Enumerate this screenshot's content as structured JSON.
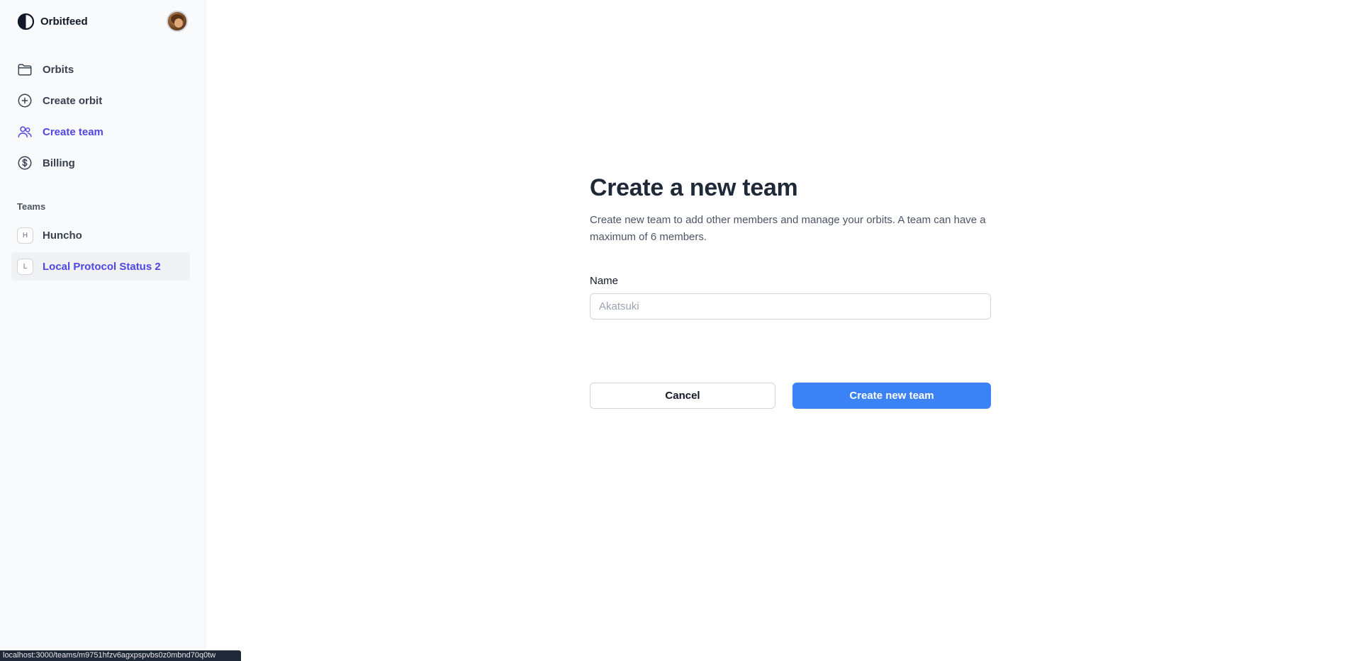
{
  "brand": {
    "name": "Orbitfeed",
    "logo_icon": "half-circle-logo-icon"
  },
  "nav": {
    "items": [
      {
        "label": "Orbits",
        "icon": "folder-icon",
        "active": false
      },
      {
        "label": "Create orbit",
        "icon": "plus-circle-icon",
        "active": false
      },
      {
        "label": "Create team",
        "icon": "users-icon",
        "active": true
      },
      {
        "label": "Billing",
        "icon": "dollar-circle-icon",
        "active": false
      }
    ]
  },
  "teams": {
    "heading": "Teams",
    "items": [
      {
        "initial": "H",
        "name": "Huncho",
        "active": false
      },
      {
        "initial": "L",
        "name": "Local Protocol Status 2",
        "active": true
      }
    ]
  },
  "form": {
    "title": "Create a new team",
    "description": "Create new team to add other members and manage your orbits. A team can have a maximum of 6 members.",
    "name_label": "Name",
    "name_placeholder": "Akatsuki",
    "name_value": "",
    "cancel_label": "Cancel",
    "submit_label": "Create new team"
  },
  "status_bar": {
    "url": "localhost:3000/teams/m9751hfzv6agxpspvbs0z0mbnd70q0tw"
  },
  "colors": {
    "accent": "#4f46e5",
    "primary_button": "#3b82f6",
    "sidebar_bg": "#f9fafb"
  }
}
